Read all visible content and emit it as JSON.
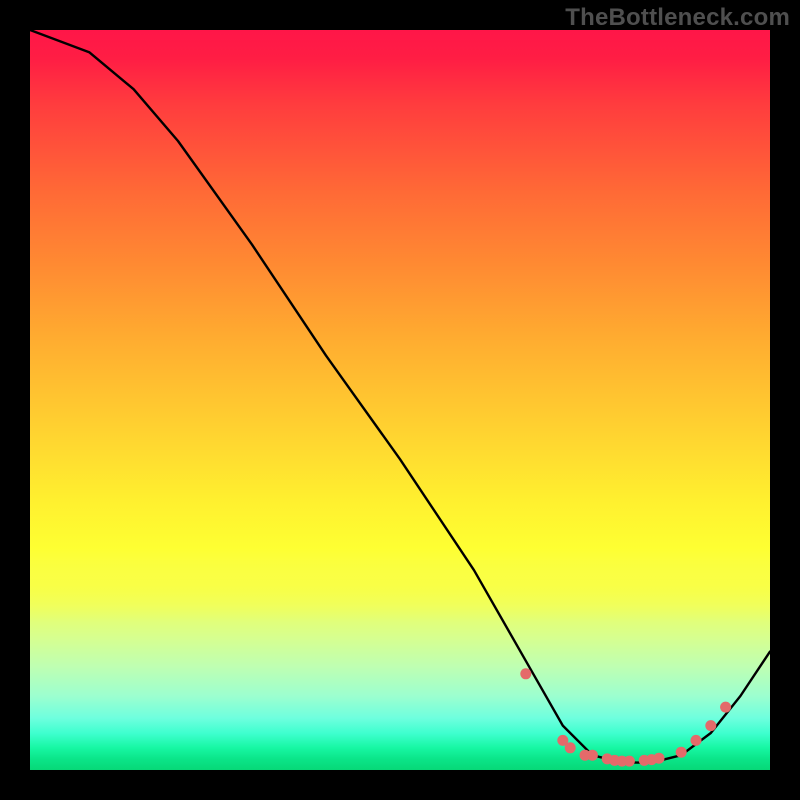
{
  "watermark": "TheBottleneck.com",
  "chart_data": {
    "type": "line",
    "title": "",
    "xlabel": "",
    "ylabel": "",
    "xlim": [
      0,
      100
    ],
    "ylim": [
      0,
      100
    ],
    "grid": false,
    "series": [
      {
        "name": "curve",
        "x": [
          0,
          8,
          14,
          20,
          30,
          40,
          50,
          60,
          68,
          72,
          76,
          80,
          84,
          88,
          92,
          96,
          100
        ],
        "y": [
          100,
          97,
          92,
          85,
          71,
          56,
          42,
          27,
          13,
          6,
          2,
          1,
          1,
          2,
          5,
          10,
          16
        ]
      }
    ],
    "markers": {
      "name": "dots",
      "x": [
        67,
        72,
        73,
        75,
        76,
        78,
        79,
        80,
        81,
        83,
        84,
        85,
        88,
        90,
        92,
        94
      ],
      "y": [
        13,
        4,
        3,
        2,
        2,
        1.5,
        1.3,
        1.2,
        1.2,
        1.3,
        1.4,
        1.6,
        2.4,
        4,
        6,
        8.5
      ]
    },
    "colors": {
      "curve_stroke": "#000000",
      "marker_fill": "#e46a6a",
      "gradient_top": "#ff1648",
      "gradient_bottom": "#07d877"
    }
  }
}
